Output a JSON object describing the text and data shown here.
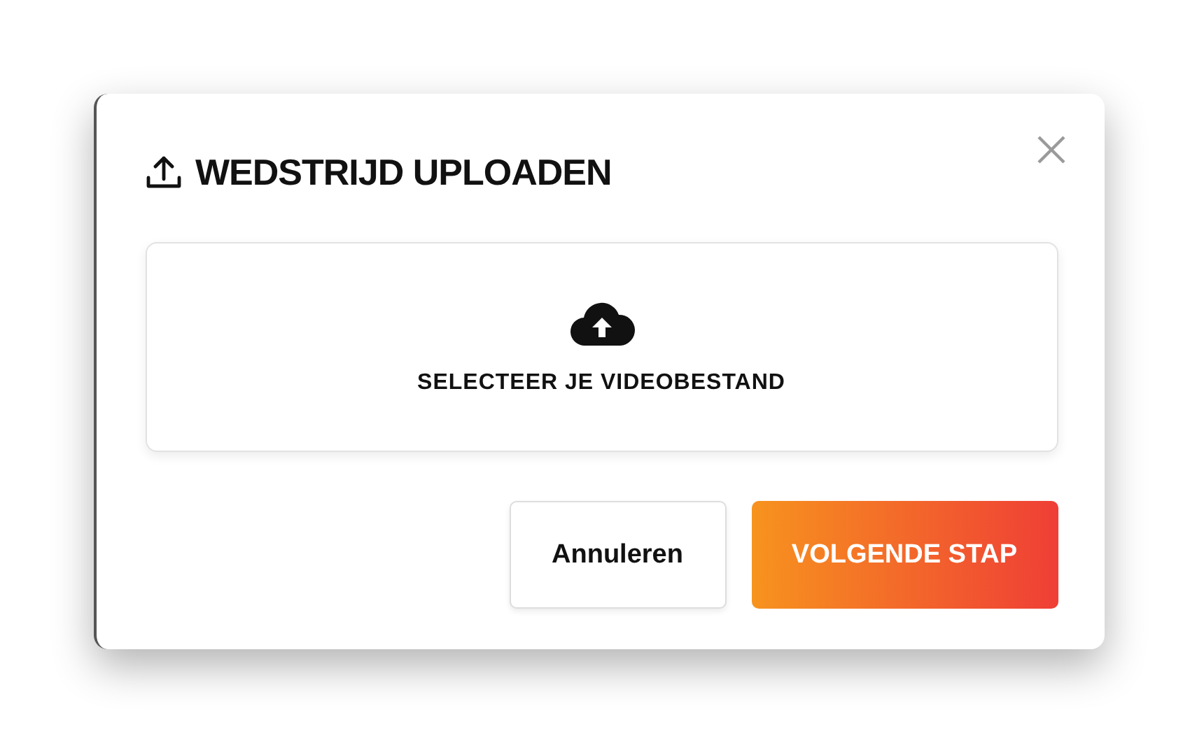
{
  "dialog": {
    "title": "WEDSTRIJD UPLOADEN",
    "dropzone": {
      "label": "SELECTEER JE VIDEOBESTAND"
    },
    "buttons": [
      {
        "label": "Annuleren",
        "kind": "secondary"
      },
      {
        "label": "VOLGENDE STAP",
        "kind": "primary"
      }
    ]
  }
}
